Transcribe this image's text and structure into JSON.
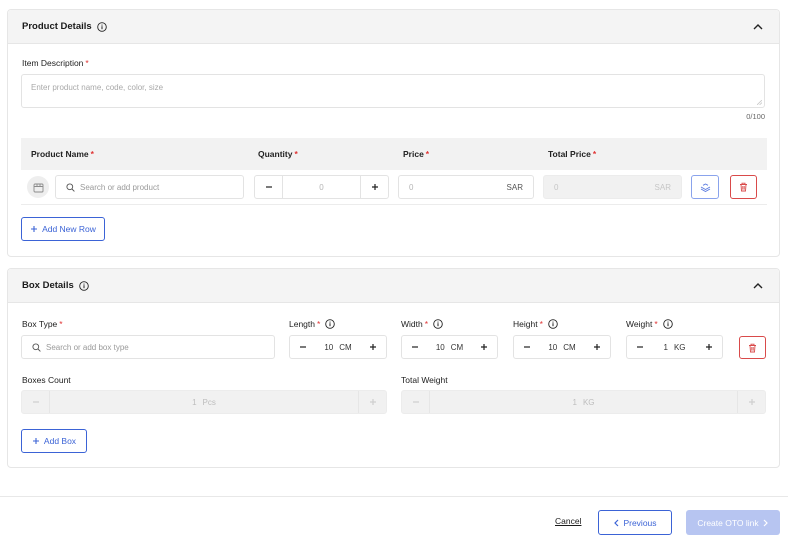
{
  "product_details": {
    "title": "Product Details",
    "item_description_label": "Item Description",
    "item_description_placeholder": "Enter product name, code, color, size",
    "char_counter": "0/100",
    "columns": {
      "product_name": "Product Name",
      "quantity": "Quantity",
      "price": "Price",
      "total_price": "Total Price"
    },
    "row": {
      "product_search_placeholder": "Search or add product",
      "quantity_value": "0",
      "price_value": "0",
      "price_currency": "SAR",
      "total_value": "0",
      "total_currency": "SAR"
    },
    "add_row_label": "Add New Row"
  },
  "box_details": {
    "title": "Box Details",
    "box_type_label": "Box Type",
    "box_type_placeholder": "Search or add box type",
    "length": {
      "label": "Length",
      "value": "10",
      "unit": "CM"
    },
    "width": {
      "label": "Width",
      "value": "10",
      "unit": "CM"
    },
    "height": {
      "label": "Height",
      "value": "10",
      "unit": "CM"
    },
    "weight": {
      "label": "Weight",
      "value": "1",
      "unit": "KG"
    },
    "boxes_count": {
      "label": "Boxes Count",
      "value": "1",
      "unit": "Pcs"
    },
    "total_weight": {
      "label": "Total Weight",
      "value": "1",
      "unit": "KG"
    },
    "add_box_label": "Add Box"
  },
  "footer": {
    "cancel_label": "Cancel",
    "previous_label": "Previous",
    "create_label": "Create OTO link"
  },
  "colors": {
    "accent": "#3b63d6",
    "required": "#e03434",
    "primary_disabled": "#b7c5f1",
    "delete": "#d94a4a"
  }
}
